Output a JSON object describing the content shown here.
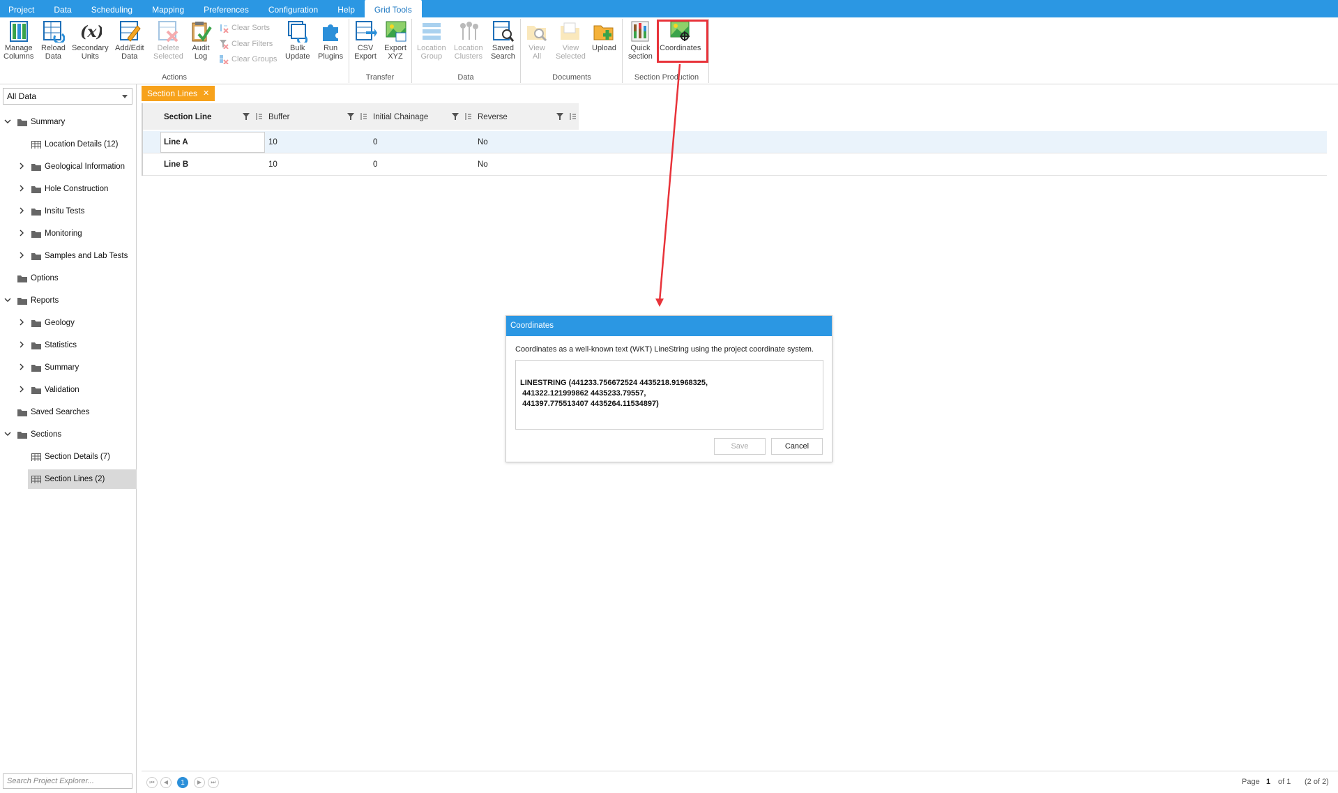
{
  "menu": {
    "items": [
      "Project",
      "Data",
      "Scheduling",
      "Mapping",
      "Preferences",
      "Configuration",
      "Help",
      "Grid Tools"
    ],
    "active": "Grid Tools"
  },
  "ribbon": {
    "buttons": [
      {
        "line1": "Manage",
        "line2": "Columns",
        "icon": "manage-columns-icon"
      },
      {
        "line1": "Reload",
        "line2": "Data",
        "icon": "reload-data-icon"
      },
      {
        "line1": "Secondary",
        "line2": "Units",
        "icon": "secondary-units-icon"
      },
      {
        "line1": "Add/Edit",
        "line2": "Data",
        "icon": "add-edit-data-icon"
      },
      {
        "line1": "Delete",
        "line2": "Selected",
        "icon": "delete-selected-icon"
      },
      {
        "line1": "Audit",
        "line2": "Log",
        "icon": "audit-log-icon"
      },
      {
        "line1": "Bulk",
        "line2": "Update",
        "icon": "bulk-update-icon"
      },
      {
        "line1": "Run",
        "line2": "Plugins",
        "icon": "run-plugins-icon"
      },
      {
        "line1": "CSV",
        "line2": "Export",
        "icon": "csv-export-icon"
      },
      {
        "line1": "Export",
        "line2": "XYZ",
        "icon": "export-xyz-icon"
      },
      {
        "line1": "Location",
        "line2": "Group",
        "icon": "location-group-icon"
      },
      {
        "line1": "Location",
        "line2": "Clusters",
        "icon": "location-clusters-icon"
      },
      {
        "line1": "Saved",
        "line2": "Search",
        "icon": "saved-search-icon"
      },
      {
        "line1": "View",
        "line2": "All",
        "icon": "view-all-icon"
      },
      {
        "line1": "View",
        "line2": "Selected",
        "icon": "view-selected-icon"
      },
      {
        "line1": "Upload",
        "line2": "",
        "icon": "upload-icon"
      },
      {
        "line1": "Quick",
        "line2": "section",
        "icon": "quick-section-icon"
      },
      {
        "line1": "Coordinates",
        "line2": "",
        "icon": "coordinates-icon"
      }
    ],
    "small_buttons": [
      "Clear Sorts",
      "Clear Filters",
      "Clear Groups"
    ],
    "groups": [
      "Actions",
      "Transfer",
      "Data",
      "Documents",
      "Section Production"
    ]
  },
  "sidebar": {
    "dropdown": "All Data",
    "tree": [
      {
        "label": "Summary",
        "level": 0,
        "type": "folder",
        "expanded": true
      },
      {
        "label": "Location Details (12)",
        "level": 1,
        "type": "table"
      },
      {
        "label": "Geological Information",
        "level": 1,
        "type": "folder",
        "expanded": false
      },
      {
        "label": "Hole Construction",
        "level": 1,
        "type": "folder",
        "expanded": false
      },
      {
        "label": "Insitu Tests",
        "level": 1,
        "type": "folder",
        "expanded": false
      },
      {
        "label": "Monitoring",
        "level": 1,
        "type": "folder",
        "expanded": false
      },
      {
        "label": "Samples and Lab Tests",
        "level": 1,
        "type": "folder",
        "expanded": false
      },
      {
        "label": "Options",
        "level": 0,
        "type": "folder-leaf"
      },
      {
        "label": "Reports",
        "level": 0,
        "type": "folder",
        "expanded": true
      },
      {
        "label": "Geology",
        "level": 1,
        "type": "folder",
        "expanded": false
      },
      {
        "label": "Statistics",
        "level": 1,
        "type": "folder",
        "expanded": false
      },
      {
        "label": "Summary",
        "level": 1,
        "type": "folder",
        "expanded": false
      },
      {
        "label": "Validation",
        "level": 1,
        "type": "folder",
        "expanded": false
      },
      {
        "label": "Saved Searches",
        "level": 0,
        "type": "folder-leaf"
      },
      {
        "label": "Sections",
        "level": 0,
        "type": "folder",
        "expanded": true
      },
      {
        "label": "Section Details (7)",
        "level": 1,
        "type": "table"
      },
      {
        "label": "Section Lines (2)",
        "level": 1,
        "type": "table",
        "selected": true
      }
    ],
    "search_placeholder": "Search Project Explorer..."
  },
  "main": {
    "tab": "Section Lines",
    "columns": [
      "Section Line",
      "Buffer",
      "Initial Chainage",
      "Reverse"
    ],
    "rows": [
      [
        "Line A",
        "10",
        "0",
        "No"
      ],
      [
        "Line B",
        "10",
        "0",
        "No"
      ]
    ],
    "pager": {
      "current": "1",
      "page_label": "Page",
      "page_value": "1",
      "of_label": "of 1",
      "count": "(2 of 2)"
    }
  },
  "dialog": {
    "title": "Coordinates",
    "description": "Coordinates as a well-known text (WKT) LineString using the project coordinate system.",
    "text": "LINESTRING (441233.756672524 4435218.91968325,\n 441322.121999862 4435233.79557,\n 441397.775513407 4435264.11534897)",
    "save": "Save",
    "cancel": "Cancel"
  },
  "colors": {
    "menubar": "#2b97e3",
    "tab": "#f7a21b",
    "highlight": "#e8333a"
  }
}
